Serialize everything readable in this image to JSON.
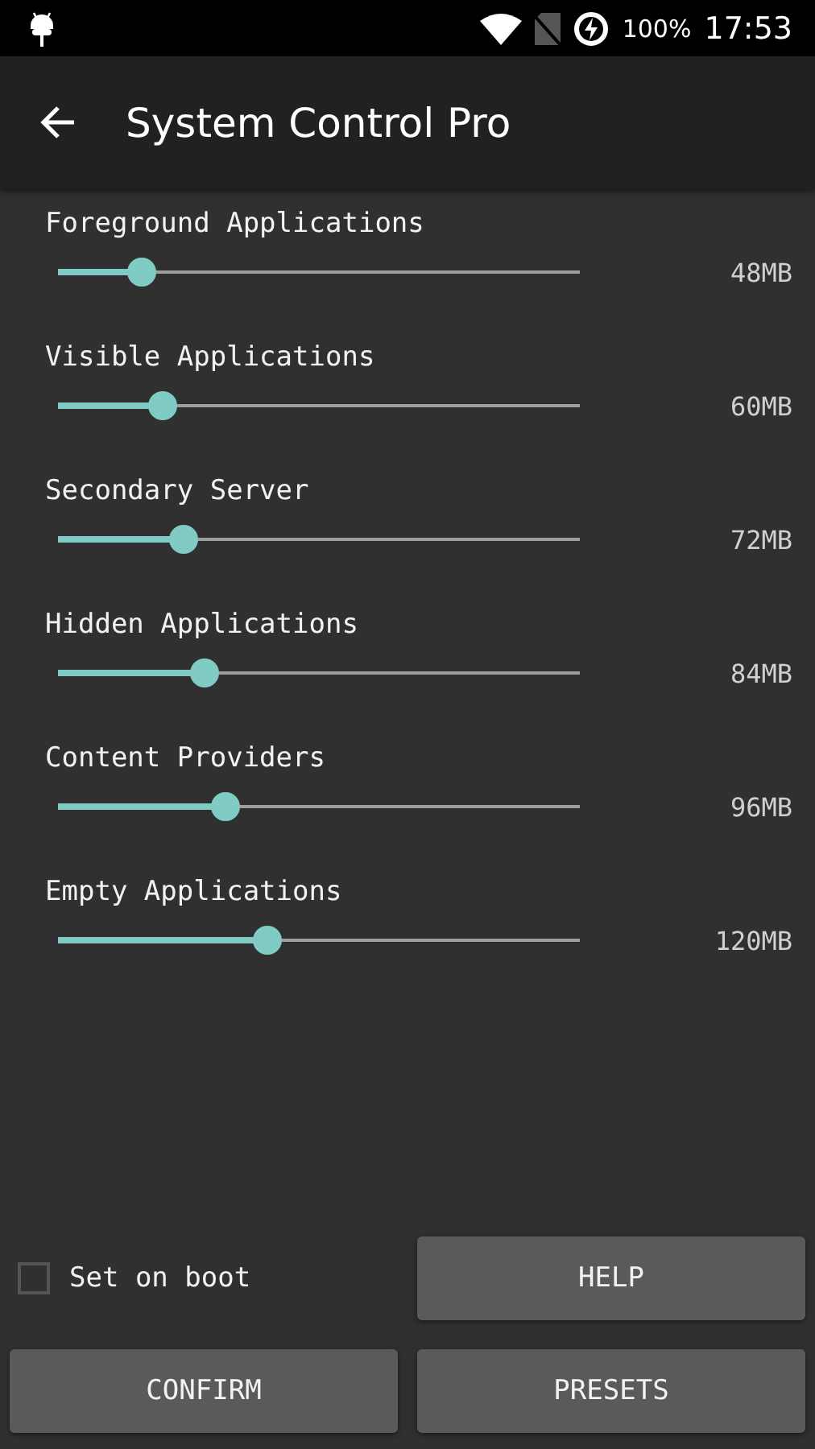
{
  "status_bar": {
    "battery": "100%",
    "time": "17:53"
  },
  "app_bar": {
    "title": "System Control Pro"
  },
  "sliders": [
    {
      "label": "Foreground Applications",
      "level": 0.16,
      "reading": "48MB"
    },
    {
      "label": "Visible Applications",
      "level": 0.2,
      "reading": "60MB"
    },
    {
      "label": "Secondary Server",
      "level": 0.24,
      "reading": "72MB"
    },
    {
      "label": "Hidden Applications",
      "level": 0.28,
      "reading": "84MB"
    },
    {
      "label": "Content Providers",
      "level": 0.32,
      "reading": "96MB"
    },
    {
      "label": "Empty Applications",
      "level": 0.4,
      "reading": "120MB"
    }
  ],
  "set_on_boot": {
    "label": "Set on boot",
    "checked": false
  },
  "buttons": [
    "HELP",
    "CONFIRM",
    "PRESETS"
  ]
}
